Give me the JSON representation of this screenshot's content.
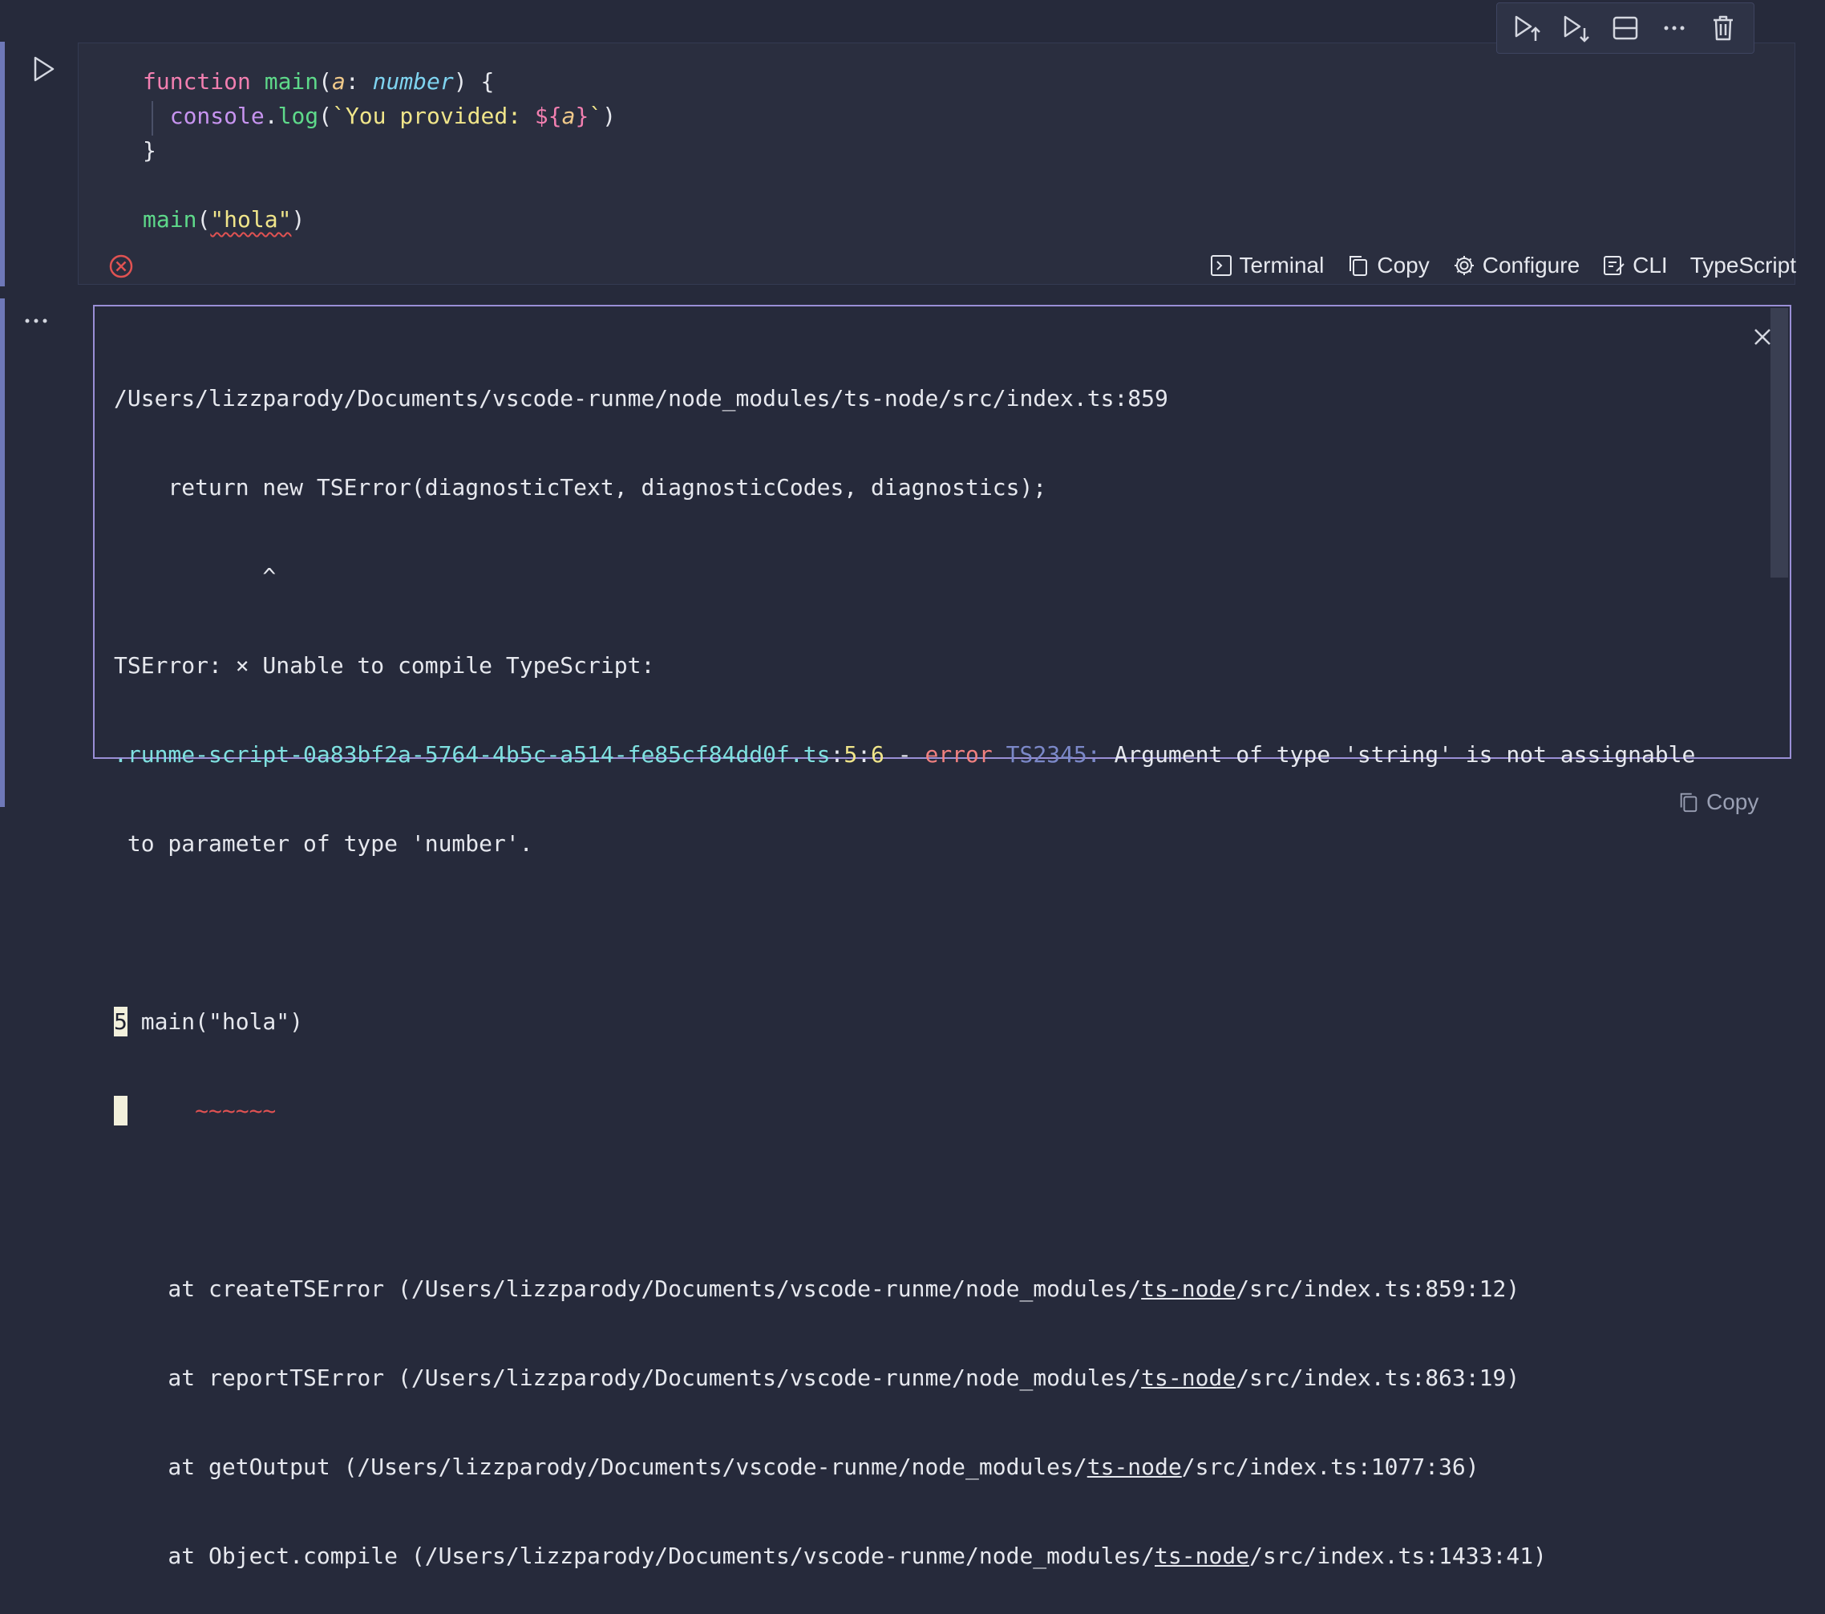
{
  "code": {
    "line1": {
      "kw": "function",
      "fn": "main",
      "open": "(",
      "param": "a",
      "colon": ": ",
      "type": "number",
      "close": ") {"
    },
    "line2": {
      "obj": "console",
      "dot": ".",
      "method": "log",
      "open": "(",
      "str1": "`You provided: ",
      "tmpl_open": "${",
      "tmpl_var": "a",
      "tmpl_close": "}",
      "str2": "`",
      "close": ")"
    },
    "line3": {
      "brace": "}"
    },
    "line5": {
      "fn": "main",
      "open": "(",
      "arg": "\"hola\"",
      "close": ")"
    }
  },
  "toolbar": {
    "icons": [
      "run-above-icon",
      "run-below-icon",
      "split-cell-icon",
      "more-icon",
      "delete-icon"
    ]
  },
  "status_bar": {
    "terminal": "Terminal",
    "copy": "Copy",
    "configure": "Configure",
    "cli": "CLI",
    "language": "TypeScript"
  },
  "output": {
    "lines": {
      "l1": "/Users/lizzparody/Documents/vscode-runme/node_modules/ts-node/src/index.ts:859",
      "l2": "    return new TSError(diagnosticText, diagnosticCodes, diagnostics);",
      "l3": "           ^",
      "l4": "TSError: × Unable to compile TypeScript:",
      "l5_file": ".runme-script-0a83bf2a-5764-4b5c-a514-fe85cf84dd0f.ts",
      "l5_sep1": ":",
      "l5_line": "5",
      "l5_sep2": ":",
      "l5_col": "6",
      "l5_dash": " - ",
      "l5_error": "error",
      "l5_space": " ",
      "l5_code": "TS2345:",
      "l5_msg": " Argument of type 'string' is not assignable",
      "l6": " to parameter of type 'number'.",
      "l8_num": "5",
      "l8_code": " main(\"hola\")",
      "l9": "     ~~~~~~",
      "stack": [
        {
          "pre": "    at createTSError (/Users/lizzparody/Documents/vscode-runme/node_modules/",
          "link": "ts-node",
          "post": "/src/index.ts:859:12)"
        },
        {
          "pre": "    at reportTSError (/Users/lizzparody/Documents/vscode-runme/node_modules/",
          "link": "ts-node",
          "post": "/src/index.ts:863:19)"
        },
        {
          "pre": "    at getOutput (/Users/lizzparody/Documents/vscode-runme/node_modules/",
          "link": "ts-node",
          "post": "/src/index.ts:1077:36)"
        },
        {
          "pre": "    at Object.compile (/Users/lizzparody/Documents/vscode-runme/node_modules/",
          "link": "ts-node",
          "post": "/src/index.ts:1433:41)"
        }
      ]
    }
  },
  "bottom": {
    "copy": "Copy"
  },
  "colors": {
    "accent": "#9a8fd6",
    "error": "#e05252",
    "background": "#262a3b"
  }
}
